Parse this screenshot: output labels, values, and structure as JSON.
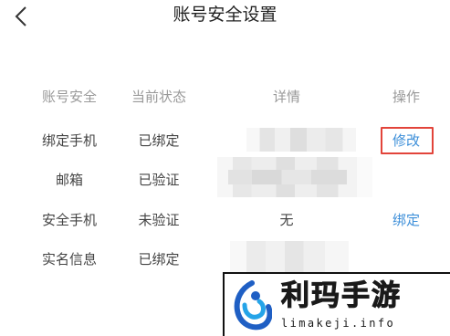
{
  "header": {
    "title": "账号安全设置"
  },
  "table": {
    "headers": {
      "item": "账号安全",
      "status": "当前状态",
      "detail": "详情",
      "action": "操作"
    },
    "rows": [
      {
        "item": "绑定手机",
        "status": "已绑定",
        "detail": "",
        "action": "修改"
      },
      {
        "item": "邮箱",
        "status": "已验证",
        "detail": "",
        "action": ""
      },
      {
        "item": "安全手机",
        "status": "未验证",
        "detail": "无",
        "action": "绑定"
      },
      {
        "item": "实名信息",
        "status": "已绑定",
        "detail": "",
        "action": ""
      }
    ]
  },
  "watermark": {
    "brand": "利玛手游",
    "url": "limakeji.info"
  },
  "colors": {
    "link": "#3d8fd9",
    "highlight": "#e2443a"
  }
}
